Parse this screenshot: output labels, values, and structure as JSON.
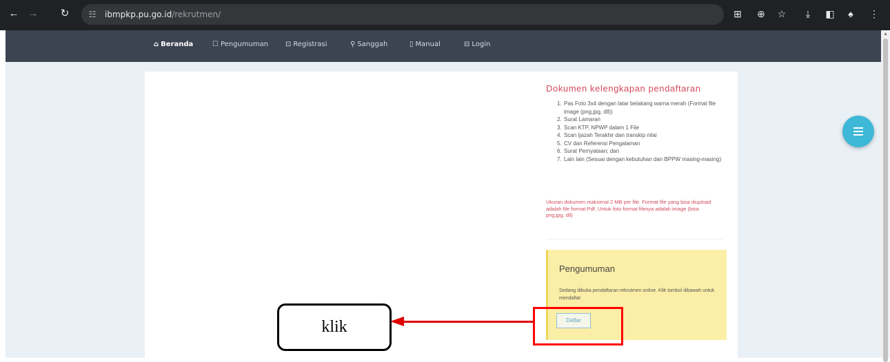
{
  "browser": {
    "url_host": "ibmpkp.pu.go.id",
    "url_path": "/rekrutmen/"
  },
  "nav": {
    "items": [
      {
        "icon": "⌂",
        "label": "Beranda"
      },
      {
        "icon": "☐",
        "label": "Pengumuman"
      },
      {
        "icon": "⊡",
        "label": "Registrasi"
      },
      {
        "icon": "⚲",
        "label": "Sanggah"
      },
      {
        "icon": "▯",
        "label": "Manual"
      },
      {
        "icon": "⊟",
        "label": "Login"
      }
    ]
  },
  "documents": {
    "title": "Dokumen kelengkapan pendaftaran",
    "items": [
      {
        "num": "1.",
        "text": "Pas Foto 3x4 dengan latar belakang warna merah (Format file image (png,jpg, dll))"
      },
      {
        "num": "2.",
        "text": "Surat Lamaran"
      },
      {
        "num": "3.",
        "text": "Scan KTP, NPWP dalam 1 File"
      },
      {
        "num": "4.",
        "text": "Scan Ijazah Terakhir dan transkip nilai"
      },
      {
        "num": "5.",
        "text": "CV dan Referensi Pengalaman"
      },
      {
        "num": "6.",
        "text": "Surat Pernyataan; dan"
      },
      {
        "num": "7.",
        "text": "Lain lain (Sesuai dengan kebutuhan dan BPPW masing-masing)"
      }
    ],
    "notes": "Ukuran dokumen maksimal 2 MB per file. Format file yang bisa diupload adalah file format Pdf. Untuk foto format filenya adalah image (bisa png,jpg, dll)"
  },
  "announcement": {
    "title": "Pengumuman",
    "text": "Sedang dibuka pendaftaran rekrutmen online. Klik tombol dibawah untuk mendaftar",
    "button": "Daftar"
  },
  "annotation": {
    "callout": "klik",
    "color": "#ff0000"
  }
}
